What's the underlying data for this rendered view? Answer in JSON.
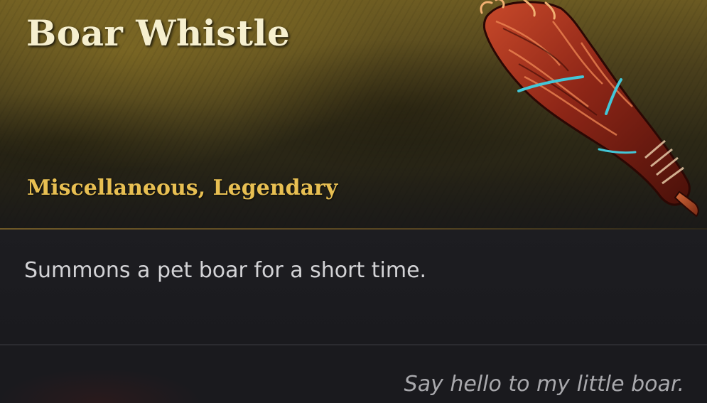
{
  "item": {
    "name": "Boar Whistle",
    "type_line": "Miscellaneous, Legendary",
    "description": "Summons a pet boar for a short time.",
    "flavor_text": "Say hello to my little boar.",
    "icon": "boar-whistle-icon"
  },
  "colors": {
    "name": "#f6efcf",
    "type_line": "#e8bf52",
    "description": "#d3d3d6",
    "flavor_text": "#a9a9ad",
    "header_accent": "#6b5a22",
    "background": "#1b1b1f"
  }
}
